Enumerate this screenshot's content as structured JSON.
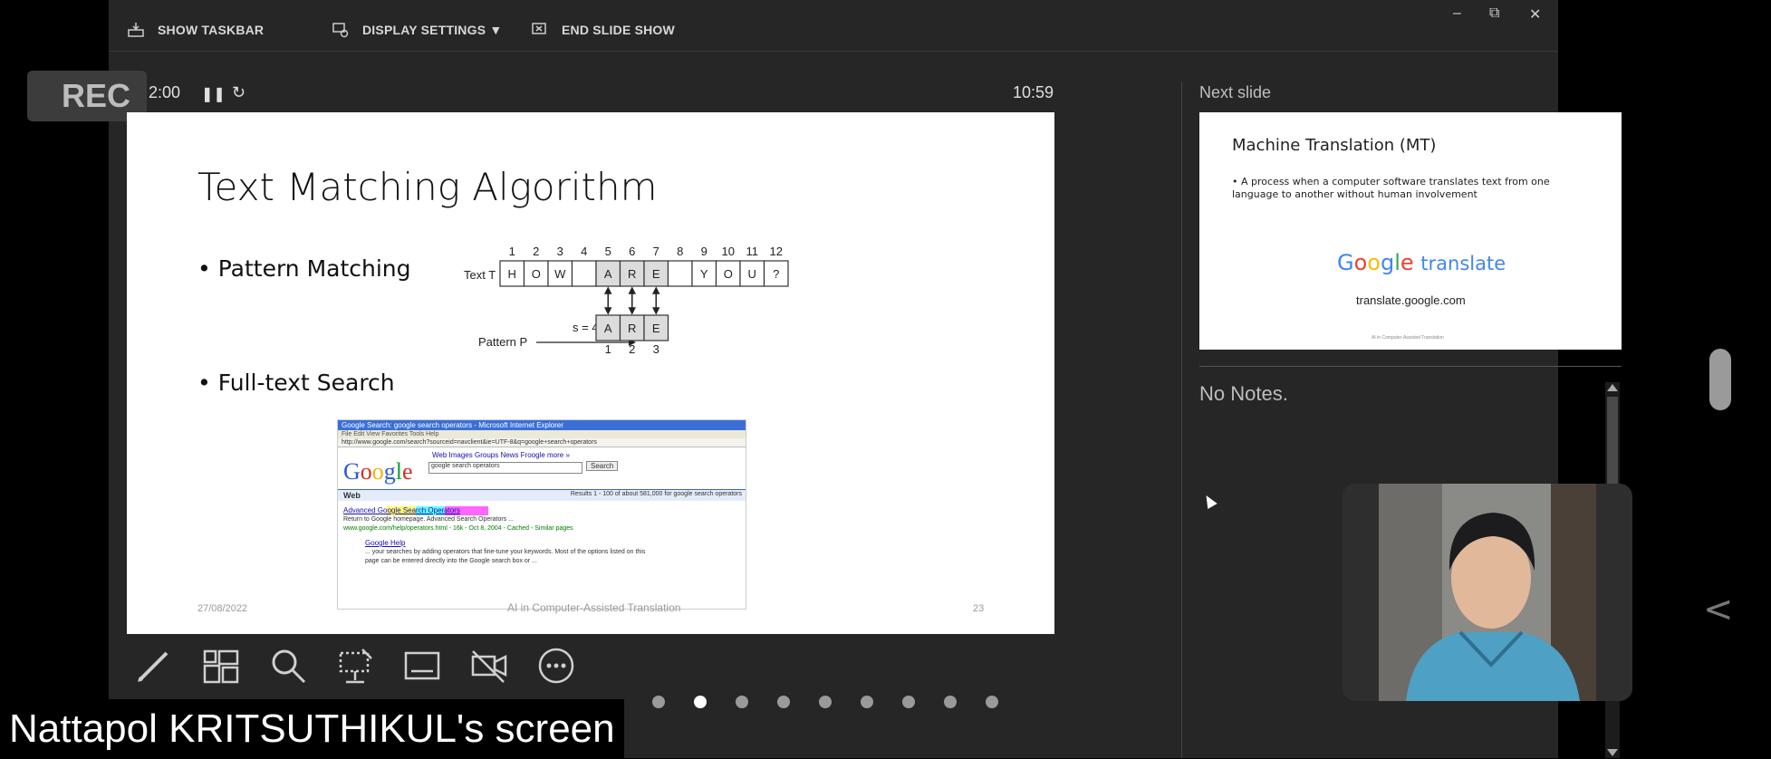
{
  "toolbar": {
    "show_taskbar": "SHOW TASKBAR",
    "display_settings": "DISPLAY SETTINGS ▼",
    "end_slide_show": "END SLIDE SHOW",
    "minimize": "–",
    "restore": "⧉",
    "close": "✕"
  },
  "recording": {
    "label": "REC",
    "elapsed": "2:00",
    "clock": "10:59"
  },
  "current_slide": {
    "title": "Text Matching Algorithm",
    "bullet1": "• Pattern Matching",
    "bullet2": "• Full-text Search",
    "diagram": {
      "indices": [
        "1",
        "2",
        "3",
        "4",
        "5",
        "6",
        "7",
        "8",
        "9",
        "10",
        "11",
        "12"
      ],
      "text_label": "Text T",
      "text_chars": [
        "H",
        "O",
        "W",
        "",
        "A",
        "R",
        "E",
        "",
        "Y",
        "O",
        "U",
        "?"
      ],
      "shift_label": "s = 4",
      "pattern_label": "Pattern P",
      "pattern_chars": [
        "A",
        "R",
        "E"
      ],
      "pattern_indices": [
        "1",
        "2",
        "3"
      ]
    },
    "screenshot": {
      "window_title": "Google Search: google search operators - Microsoft Internet Explorer",
      "menu": "File   Edit   View   Favorites   Tools   Help",
      "address": "http://www.google.com/search?sourceid=navclient&ie=UTF-8&q=google+search+operators",
      "nav_links": "Web   Images   Groups   News   Froogle   more »",
      "query": "google search operators",
      "search_button": "Search",
      "logo": "Google",
      "results_header": "Web",
      "results_count": "Results 1 - 100 of about 581,000 for google search operators",
      "result1_title": "Advanced Google Search Operators",
      "result1_snippet": "Return to Google homepage. Advanced Search Operators ...",
      "result1_url": "www.google.com/help/operators.html - 16k - Oct 8, 2004 - Cached - Similar pages",
      "result2_title": "Google Help",
      "result2_snippet": "... your searches by adding operators that fine-tune your keywords. Most of the options listed on this page can be entered directly into the Google search box or ..."
    },
    "footer_date": "27/08/2022",
    "footer_center": "AI in Computer-Assisted Translation",
    "footer_page": "23"
  },
  "next_slide": {
    "label": "Next slide",
    "title": "Machine Translation (MT)",
    "bullet": "• A process when a computer software translates text from one language to another without human involvement",
    "logo_text": "Google translate",
    "url": "translate.google.com",
    "footer_center": "AI in Computer-Assisted Translation"
  },
  "notes": {
    "text": "No Notes."
  },
  "tools": [
    "pen-tool",
    "see-all-slides",
    "zoom",
    "laser-pointer",
    "subtitles",
    "camera-off",
    "more-options"
  ],
  "page_dots": {
    "count": 9,
    "active_index": 1
  },
  "caption": "Nattapol KRITSUTHIKUL's screen",
  "colors": {
    "background": "#262626",
    "accent_yellow": "#ffff00",
    "accent_cyan": "#00ffff",
    "accent_magenta": "#ff00ff"
  }
}
